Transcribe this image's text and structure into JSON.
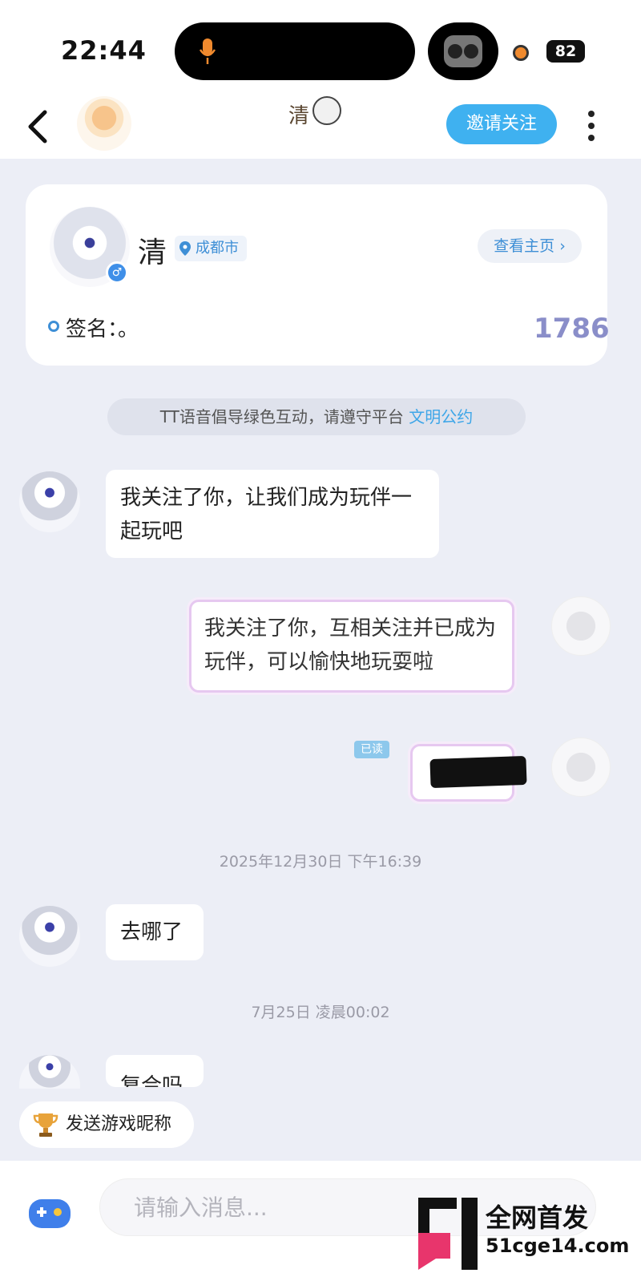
{
  "status_bar": {
    "time": "22:44",
    "battery": "82"
  },
  "header": {
    "title": "清",
    "invite_follow_label": "邀请关注"
  },
  "profile": {
    "name": "清",
    "location": "成都市",
    "view_homepage_label": "查看主页 ›",
    "signature": "签名：。",
    "number": "1786"
  },
  "notice": {
    "text": "TT语音倡导绿色互动，请遵守平台 ",
    "link": "文明公约"
  },
  "messages": [
    {
      "side": "left",
      "text": "我关注了你，让我们成为玩伴一起玩吧"
    },
    {
      "side": "right",
      "text": "我关注了你，互相关注并已成为玩伴，可以愉快地玩耍啦"
    },
    {
      "side": "right",
      "read_badge": "已读",
      "redacted": true
    },
    {
      "timestamp": "2025年12月30日 下午16:39"
    },
    {
      "side": "left",
      "text": "去哪了"
    },
    {
      "timestamp": "7月25日 凌晨00:02"
    },
    {
      "side": "left",
      "text": "复合吗"
    }
  ],
  "quick_action": {
    "send_nickname_label": "发送游戏昵称"
  },
  "input": {
    "placeholder": "请输入消息..."
  },
  "watermark": {
    "title": "全网首发",
    "domain": "51cge14.com"
  },
  "colors": {
    "accent": "#3fb1f0",
    "background": "#eceef6",
    "link": "#3ea6e8"
  }
}
